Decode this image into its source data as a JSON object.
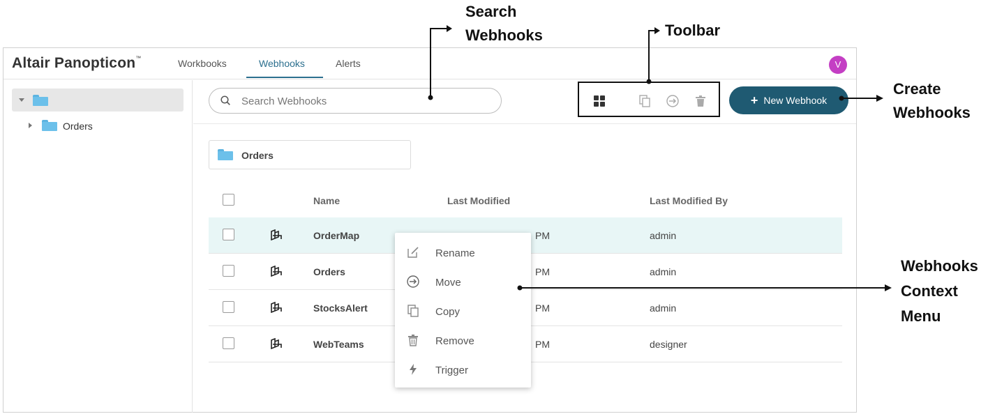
{
  "app": {
    "brand": "Altair Panopticon",
    "tabs": [
      {
        "label": "Workbooks",
        "active": false
      },
      {
        "label": "Webhooks",
        "active": true
      },
      {
        "label": "Alerts",
        "active": false
      }
    ],
    "avatar_initial": "V",
    "avatar_color": "#c43fc4",
    "accent_color": "#1f5a72"
  },
  "sidebar": {
    "tree": [
      {
        "label": "",
        "icon": "folder-icon",
        "expanded": true,
        "selected": true
      },
      {
        "label": "Orders",
        "icon": "folder-icon",
        "expanded": false
      }
    ]
  },
  "toolbar": {
    "search_placeholder": "Search Webhooks",
    "icons": [
      "grid-view-icon",
      "copy-icon",
      "move-icon",
      "trash-icon"
    ],
    "new_button_label": "New Webhook"
  },
  "breadcrumb": {
    "label": "Orders",
    "icon": "folder-icon"
  },
  "table": {
    "columns": [
      "Name",
      "Last Modified",
      "Last Modified By"
    ],
    "rows": [
      {
        "name": "OrderMap",
        "last_modified": "PM",
        "last_modified_by": "admin",
        "selected": true
      },
      {
        "name": "Orders",
        "last_modified": "PM",
        "last_modified_by": "admin",
        "selected": false
      },
      {
        "name": "StocksAlert",
        "last_modified": "PM",
        "last_modified_by": "admin",
        "selected": false
      },
      {
        "name": "WebTeams",
        "last_modified": "PM",
        "last_modified_by": "designer",
        "selected": false
      }
    ]
  },
  "context_menu": {
    "items": [
      {
        "label": "Rename",
        "icon": "rename-icon"
      },
      {
        "label": "Move",
        "icon": "move-icon"
      },
      {
        "label": "Copy",
        "icon": "copy-icon"
      },
      {
        "label": "Remove",
        "icon": "trash-icon"
      },
      {
        "label": "Trigger",
        "icon": "lightning-icon"
      }
    ]
  },
  "annotations": {
    "search": [
      "Search",
      "Webhooks"
    ],
    "toolbar": "Toolbar",
    "create": [
      "Create",
      "Webhooks"
    ],
    "context": [
      "Webhooks",
      "Context",
      "Menu"
    ]
  }
}
